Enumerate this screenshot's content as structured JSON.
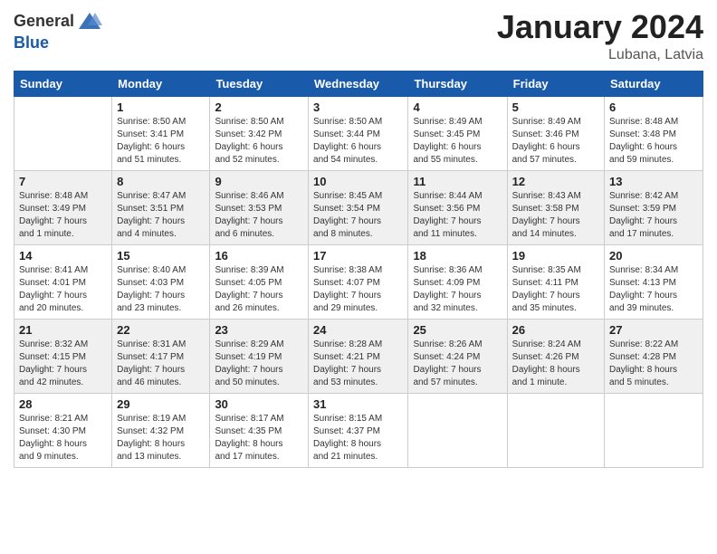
{
  "header": {
    "logo_general": "General",
    "logo_blue": "Blue",
    "title": "January 2024",
    "location": "Lubana, Latvia"
  },
  "columns": [
    "Sunday",
    "Monday",
    "Tuesday",
    "Wednesday",
    "Thursday",
    "Friday",
    "Saturday"
  ],
  "weeks": [
    {
      "days": [
        {
          "num": "",
          "info": ""
        },
        {
          "num": "1",
          "info": "Sunrise: 8:50 AM\nSunset: 3:41 PM\nDaylight: 6 hours\nand 51 minutes."
        },
        {
          "num": "2",
          "info": "Sunrise: 8:50 AM\nSunset: 3:42 PM\nDaylight: 6 hours\nand 52 minutes."
        },
        {
          "num": "3",
          "info": "Sunrise: 8:50 AM\nSunset: 3:44 PM\nDaylight: 6 hours\nand 54 minutes."
        },
        {
          "num": "4",
          "info": "Sunrise: 8:49 AM\nSunset: 3:45 PM\nDaylight: 6 hours\nand 55 minutes."
        },
        {
          "num": "5",
          "info": "Sunrise: 8:49 AM\nSunset: 3:46 PM\nDaylight: 6 hours\nand 57 minutes."
        },
        {
          "num": "6",
          "info": "Sunrise: 8:48 AM\nSunset: 3:48 PM\nDaylight: 6 hours\nand 59 minutes."
        }
      ]
    },
    {
      "days": [
        {
          "num": "7",
          "info": "Sunrise: 8:48 AM\nSunset: 3:49 PM\nDaylight: 7 hours\nand 1 minute."
        },
        {
          "num": "8",
          "info": "Sunrise: 8:47 AM\nSunset: 3:51 PM\nDaylight: 7 hours\nand 4 minutes."
        },
        {
          "num": "9",
          "info": "Sunrise: 8:46 AM\nSunset: 3:53 PM\nDaylight: 7 hours\nand 6 minutes."
        },
        {
          "num": "10",
          "info": "Sunrise: 8:45 AM\nSunset: 3:54 PM\nDaylight: 7 hours\nand 8 minutes."
        },
        {
          "num": "11",
          "info": "Sunrise: 8:44 AM\nSunset: 3:56 PM\nDaylight: 7 hours\nand 11 minutes."
        },
        {
          "num": "12",
          "info": "Sunrise: 8:43 AM\nSunset: 3:58 PM\nDaylight: 7 hours\nand 14 minutes."
        },
        {
          "num": "13",
          "info": "Sunrise: 8:42 AM\nSunset: 3:59 PM\nDaylight: 7 hours\nand 17 minutes."
        }
      ]
    },
    {
      "days": [
        {
          "num": "14",
          "info": "Sunrise: 8:41 AM\nSunset: 4:01 PM\nDaylight: 7 hours\nand 20 minutes."
        },
        {
          "num": "15",
          "info": "Sunrise: 8:40 AM\nSunset: 4:03 PM\nDaylight: 7 hours\nand 23 minutes."
        },
        {
          "num": "16",
          "info": "Sunrise: 8:39 AM\nSunset: 4:05 PM\nDaylight: 7 hours\nand 26 minutes."
        },
        {
          "num": "17",
          "info": "Sunrise: 8:38 AM\nSunset: 4:07 PM\nDaylight: 7 hours\nand 29 minutes."
        },
        {
          "num": "18",
          "info": "Sunrise: 8:36 AM\nSunset: 4:09 PM\nDaylight: 7 hours\nand 32 minutes."
        },
        {
          "num": "19",
          "info": "Sunrise: 8:35 AM\nSunset: 4:11 PM\nDaylight: 7 hours\nand 35 minutes."
        },
        {
          "num": "20",
          "info": "Sunrise: 8:34 AM\nSunset: 4:13 PM\nDaylight: 7 hours\nand 39 minutes."
        }
      ]
    },
    {
      "days": [
        {
          "num": "21",
          "info": "Sunrise: 8:32 AM\nSunset: 4:15 PM\nDaylight: 7 hours\nand 42 minutes."
        },
        {
          "num": "22",
          "info": "Sunrise: 8:31 AM\nSunset: 4:17 PM\nDaylight: 7 hours\nand 46 minutes."
        },
        {
          "num": "23",
          "info": "Sunrise: 8:29 AM\nSunset: 4:19 PM\nDaylight: 7 hours\nand 50 minutes."
        },
        {
          "num": "24",
          "info": "Sunrise: 8:28 AM\nSunset: 4:21 PM\nDaylight: 7 hours\nand 53 minutes."
        },
        {
          "num": "25",
          "info": "Sunrise: 8:26 AM\nSunset: 4:24 PM\nDaylight: 7 hours\nand 57 minutes."
        },
        {
          "num": "26",
          "info": "Sunrise: 8:24 AM\nSunset: 4:26 PM\nDaylight: 8 hours\nand 1 minute."
        },
        {
          "num": "27",
          "info": "Sunrise: 8:22 AM\nSunset: 4:28 PM\nDaylight: 8 hours\nand 5 minutes."
        }
      ]
    },
    {
      "days": [
        {
          "num": "28",
          "info": "Sunrise: 8:21 AM\nSunset: 4:30 PM\nDaylight: 8 hours\nand 9 minutes."
        },
        {
          "num": "29",
          "info": "Sunrise: 8:19 AM\nSunset: 4:32 PM\nDaylight: 8 hours\nand 13 minutes."
        },
        {
          "num": "30",
          "info": "Sunrise: 8:17 AM\nSunset: 4:35 PM\nDaylight: 8 hours\nand 17 minutes."
        },
        {
          "num": "31",
          "info": "Sunrise: 8:15 AM\nSunset: 4:37 PM\nDaylight: 8 hours\nand 21 minutes."
        },
        {
          "num": "",
          "info": ""
        },
        {
          "num": "",
          "info": ""
        },
        {
          "num": "",
          "info": ""
        }
      ]
    }
  ]
}
